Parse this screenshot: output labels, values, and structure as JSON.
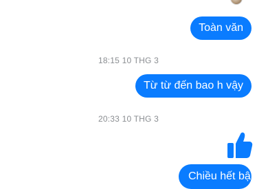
{
  "messages": [
    {
      "text": "Toàn văn"
    },
    {
      "timestamp": "18:15 10 THG 3"
    },
    {
      "text": "Từ từ đến bao h vậy"
    },
    {
      "timestamp": "20:33 10 THG 3"
    },
    {
      "reaction": "thumbs-up-icon"
    },
    {
      "text": "Chiều hết bận"
    }
  ],
  "colors": {
    "bubble": "#0a7cff",
    "timestamp": "#8a8d91",
    "background": "#ffffff"
  }
}
